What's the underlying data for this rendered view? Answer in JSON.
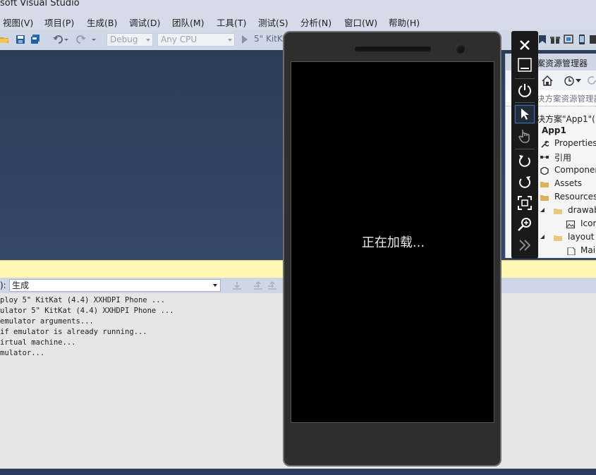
{
  "window": {
    "title": "soft Visual Studio"
  },
  "menu": [
    "视图(V)",
    "项目(P)",
    "生成(B)",
    "调试(D)",
    "团队(M)",
    "工具(T)",
    "测试(S)",
    "分析(N)",
    "窗口(W)",
    "帮助(H)"
  ],
  "toolbar": {
    "config": "Debug",
    "platform": "Any CPU",
    "run_target": "5\" KitK"
  },
  "output": {
    "label": "):",
    "source": "生成",
    "lines": [
      "ploy 5\" KitKat (4.4) XXHDPI Phone ...",
      "ulator 5\" KitKat (4.4) XXHDPI Phone ...",
      "emulator arguments...",
      " if emulator is already running...",
      "irtual machine...",
      "mulator..."
    ]
  },
  "solution_explorer": {
    "title": "案资源管理器",
    "search_placeholder": "决方案资源管理器",
    "items": [
      {
        "label": "决方案\"App1\"(",
        "icon": "solution-icon"
      },
      {
        "label": "App1",
        "icon": "project-icon"
      },
      {
        "label": "Properties",
        "icon": "wrench-icon"
      },
      {
        "label": "引用",
        "icon": "references-icon"
      },
      {
        "label": "Componen",
        "icon": "component-icon"
      },
      {
        "label": "Assets",
        "icon": "folder-icon"
      },
      {
        "label": "Resources",
        "icon": "folder-icon"
      },
      {
        "label": "drawab",
        "icon": "folder-icon"
      },
      {
        "label": "Icon",
        "icon": "image-icon"
      },
      {
        "label": "layout",
        "icon": "folder-icon"
      },
      {
        "label": "Mai",
        "icon": "file-icon"
      }
    ]
  },
  "emulator": {
    "loading_text": "正在加载...",
    "tools": [
      "close-icon",
      "minimize-icon",
      "power-icon",
      "pointer-icon",
      "touch-icon",
      "rotate-left-icon",
      "rotate-right-icon",
      "fit-screen-icon",
      "zoom-icon",
      "more-tools-icon"
    ]
  },
  "colors": {
    "editor_bg": "#2c3d59",
    "info_bar": "#fff6b4",
    "phone_body": "#2e2e2e",
    "screen": "#000000"
  }
}
